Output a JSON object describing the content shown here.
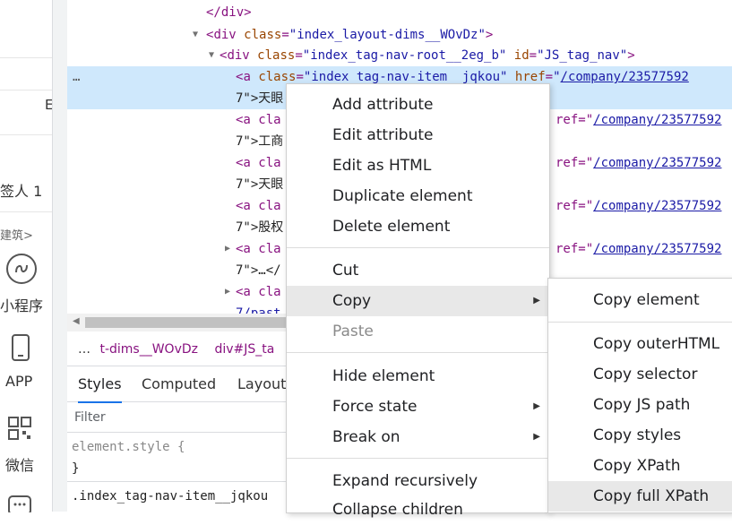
{
  "page_left": {
    "text_a": "E",
    "text_b": "签人 1",
    "text_c": "建筑>",
    "mini_program": "小程序",
    "app": "APP",
    "wechat": "微信"
  },
  "tree": {
    "lines": [
      {
        "pre": "</div>"
      },
      {
        "tag": "div",
        "attrs": [
          {
            "n": "class",
            "v": "\"index_layout-dims__WOvDz\""
          }
        ]
      },
      {
        "tag": "div",
        "attrs": [
          {
            "n": "class",
            "v": "\"index_tag-nav-root__2eg_b\""
          },
          {
            "n": "id",
            "v": "\"JS_tag_nav\""
          }
        ]
      },
      {
        "tag": "a",
        "attrs": [
          {
            "n": "class",
            "v": "\"index_tag-nav-item__jqkou\""
          },
          {
            "n": "href",
            "v": "\""
          }
        ],
        "link": "/company/23577592",
        "cont": "7\">天眼"
      },
      {
        "partial": "<a cla",
        "href_tail": "ref=\"",
        "link": "/company/23577592",
        "cont": "7\">工商"
      },
      {
        "partial": "<a cla",
        "href_tail": "ref=\"",
        "link": "/company/23577592",
        "cont": "7\">天眼"
      },
      {
        "partial": "<a cla",
        "href_tail": "ref=\"",
        "link": "/company/23577592",
        "cont": "7\">股权"
      },
      {
        "partial": "<a cla",
        "href_tail": "ref=\"",
        "link": "/company/23577592",
        "cont": "7\">…</"
      },
      {
        "partial": "<a cla",
        "cont": "7/past"
      }
    ],
    "more": "…"
  },
  "breadcrumb": {
    "dots": "…",
    "item1": "t-dims__WOvDz",
    "item2": "div#JS_ta"
  },
  "styles": {
    "tabs": [
      "Styles",
      "Computed",
      "Layout"
    ],
    "filter_placeholder": "Filter",
    "rule1": "element.style {",
    "rule1_end": "}",
    "rule2": ".index_tag-nav-item__jqkou"
  },
  "context_menu": {
    "items": [
      "Add attribute",
      "Edit attribute",
      "Edit as HTML",
      "Duplicate element",
      "Delete element",
      "Cut",
      "Copy",
      "Paste",
      "Hide element",
      "Force state",
      "Break on",
      "Expand recursively",
      "Collapse children"
    ]
  },
  "copy_submenu": {
    "items": [
      "Copy element",
      "Copy outerHTML",
      "Copy selector",
      "Copy JS path",
      "Copy styles",
      "Copy XPath",
      "Copy full XPath"
    ]
  }
}
